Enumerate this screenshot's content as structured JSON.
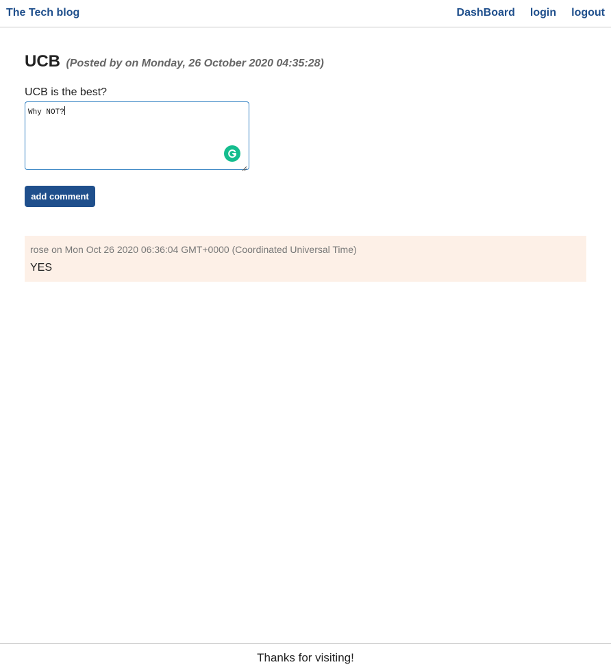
{
  "header": {
    "brand": "The Tech blog",
    "nav": {
      "dashboard": "DashBoard",
      "login": "login",
      "logout": "logout"
    }
  },
  "post": {
    "title": "UCB",
    "meta": "(Posted by on Monday, 26 October 2020 04:35:28)",
    "body": "UCB is the best?"
  },
  "comment_form": {
    "value": "Why NOT?",
    "button_label": "add comment"
  },
  "comments": [
    {
      "meta": "rose on Mon Oct 26 2020 06:36:04 GMT+0000 (Coordinated Universal Time)",
      "text": "YES"
    }
  ],
  "footer": {
    "text": "Thanks for visiting!"
  },
  "colors": {
    "accent": "#1f4f8c",
    "comment_bg": "#fdf0e7",
    "grammarly": "#15bd8e"
  },
  "icons": {
    "grammarly": "grammarly-icon",
    "resize": "resize-handle-icon"
  }
}
